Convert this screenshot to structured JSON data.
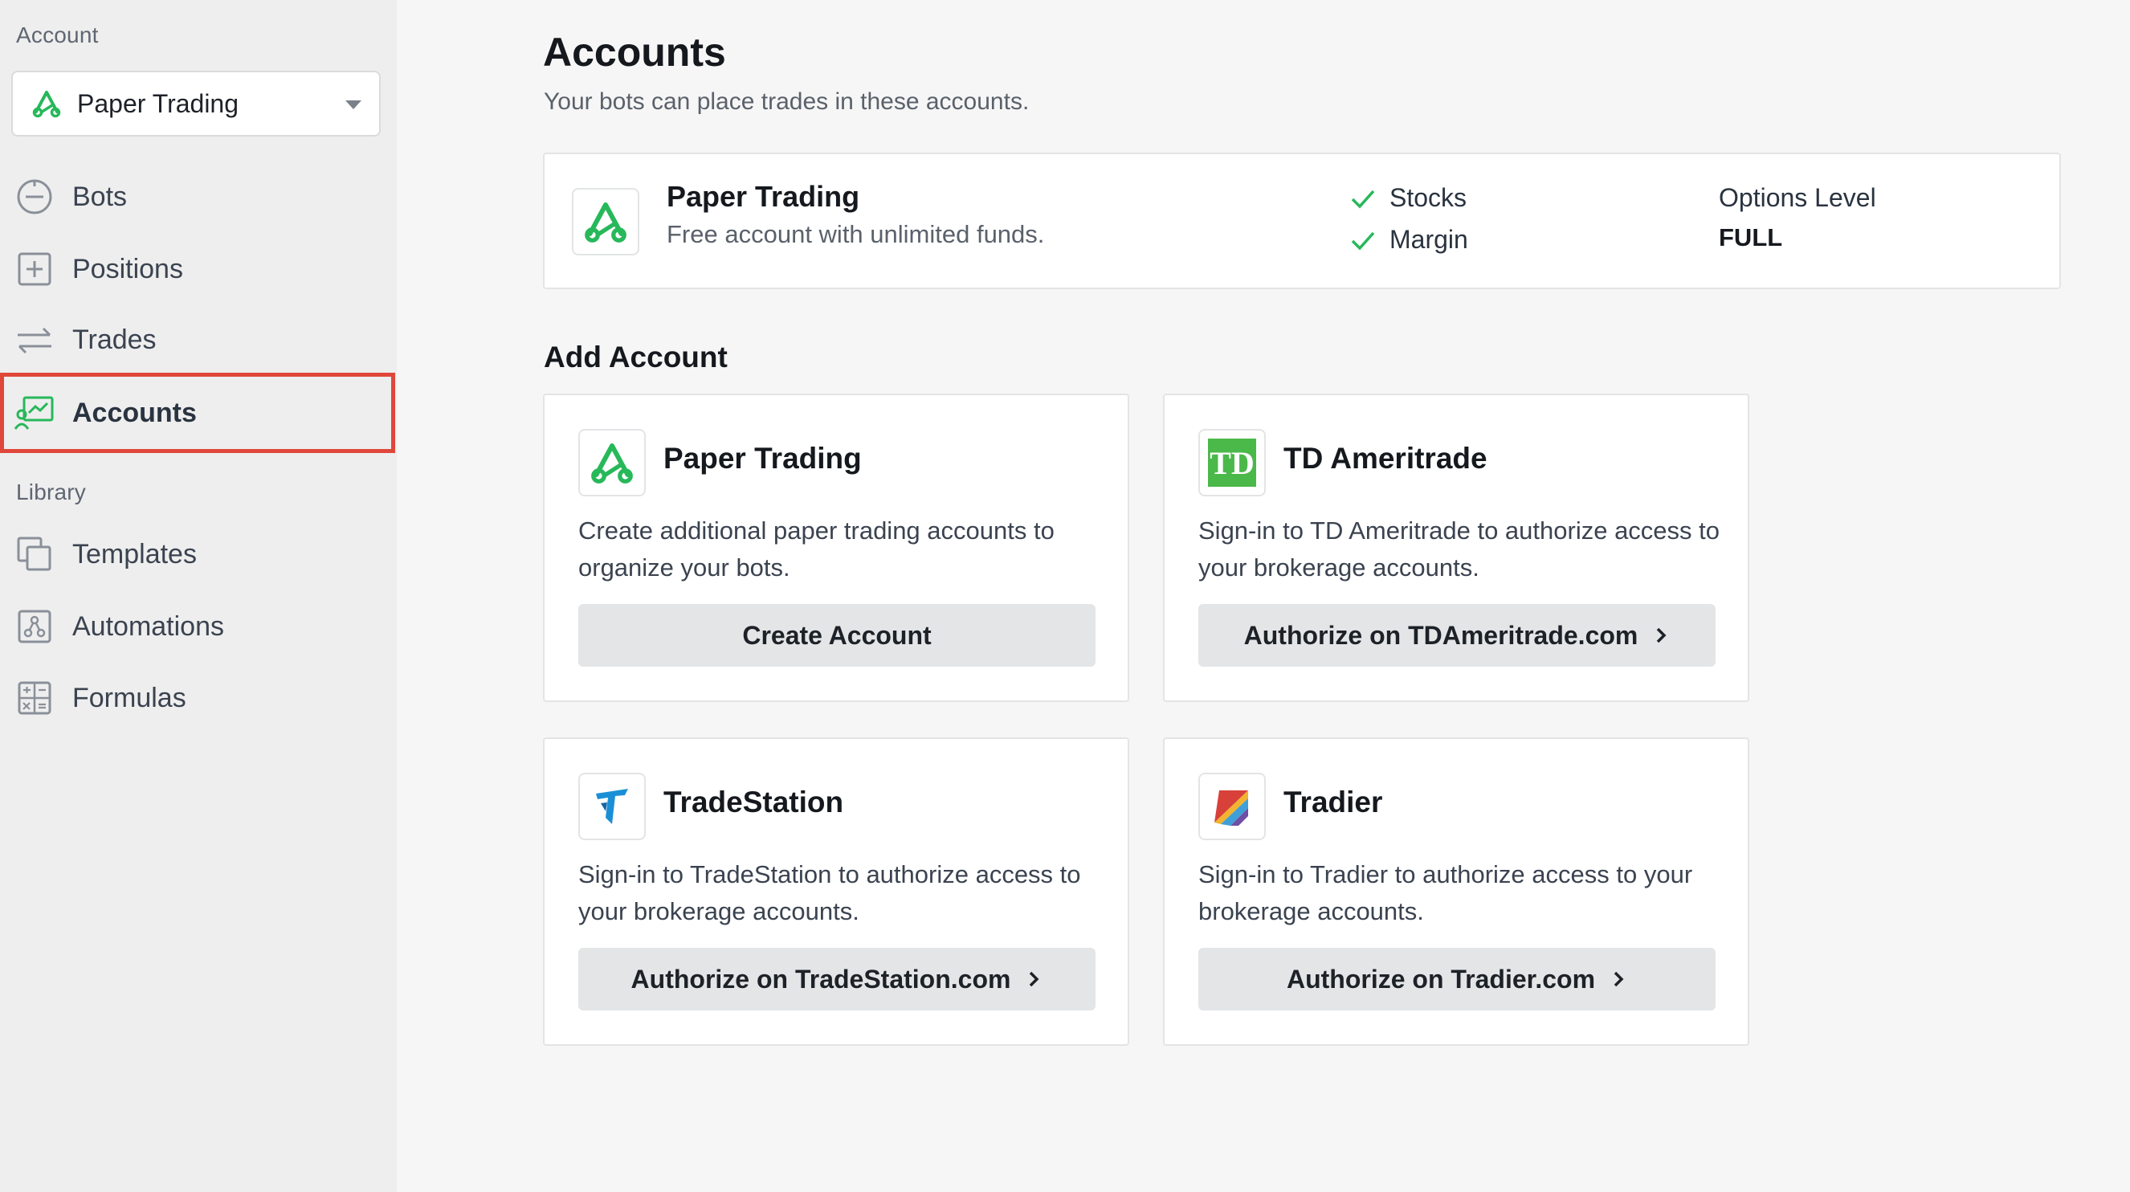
{
  "sidebar": {
    "account_heading": "Account",
    "account_select": {
      "value": "Paper Trading"
    },
    "library_heading": "Library",
    "nav": [
      {
        "label": "Bots",
        "icon": "power-icon"
      },
      {
        "label": "Positions",
        "icon": "plus-square-icon"
      },
      {
        "label": "Trades",
        "icon": "arrows-swap-icon"
      },
      {
        "label": "Accounts",
        "icon": "account-chart-icon",
        "active": true
      }
    ],
    "library": [
      {
        "label": "Templates",
        "icon": "copy-icon"
      },
      {
        "label": "Automations",
        "icon": "automation-icon"
      },
      {
        "label": "Formulas",
        "icon": "calculator-icon"
      }
    ]
  },
  "main": {
    "title": "Accounts",
    "subtitle": "Your bots can place trades in these accounts.",
    "current_account": {
      "name": "Paper Trading",
      "description": "Free account with unlimited funds.",
      "features": [
        "Stocks",
        "Margin"
      ],
      "options_label": "Options Level",
      "options_value": "FULL"
    },
    "add_section_title": "Add Account",
    "add_cards": [
      {
        "name": "Paper Trading",
        "description": "Create additional paper trading accounts to organize your bots.",
        "button": "Create Account",
        "icon": "paper-trading-logo-icon"
      },
      {
        "name": "TD Ameritrade",
        "description": "Sign-in to TD Ameritrade to authorize access to your brokerage accounts.",
        "button": "Authorize on TDAmeritrade.com",
        "icon": "td-ameritrade-logo-icon"
      },
      {
        "name": "TradeStation",
        "description": "Sign-in to TradeStation to authorize access to your brokerage accounts.",
        "button": "Authorize on TradeStation.com",
        "icon": "tradestation-logo-icon"
      },
      {
        "name": "Tradier",
        "description": "Sign-in to Tradier to authorize access to your brokerage accounts.",
        "button": "Authorize on Tradier.com",
        "icon": "tradier-logo-icon"
      }
    ]
  },
  "colors": {
    "brand_green": "#27b85a",
    "td_green": "#4bb84a",
    "highlight_red": "#e0473b",
    "button_bg": "#e4e5e7"
  }
}
